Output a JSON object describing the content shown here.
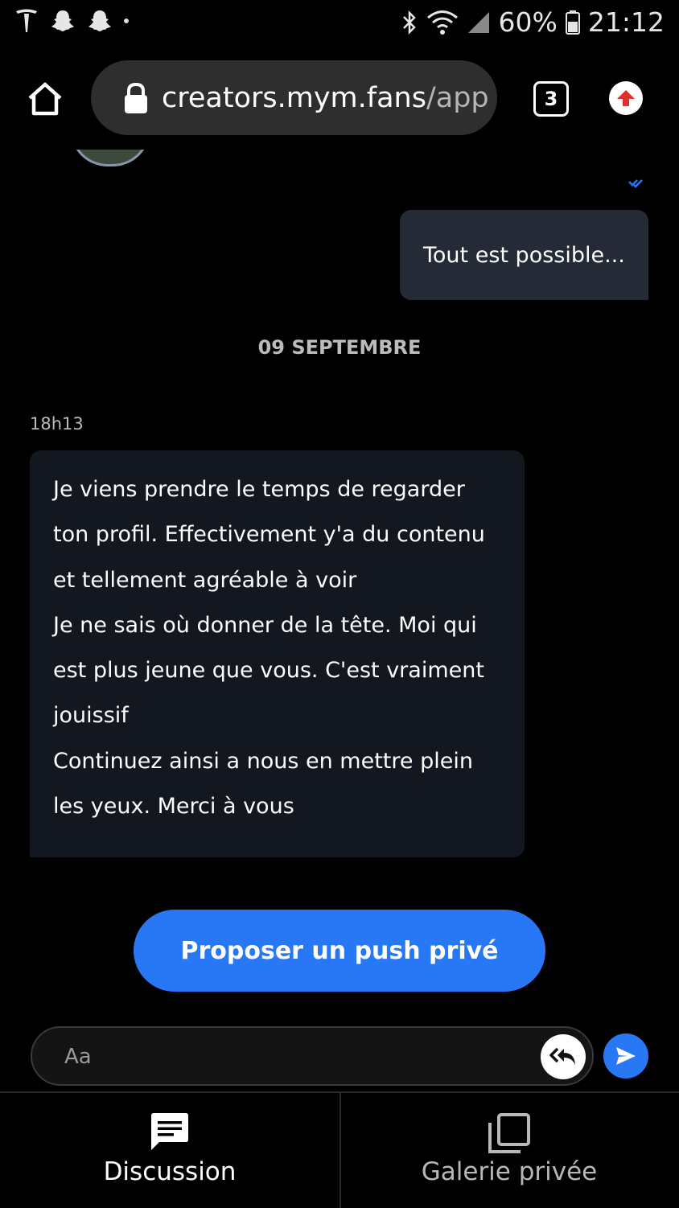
{
  "status_bar": {
    "battery": "60%",
    "time": "21:12",
    "left_icons": [
      "tesla-icon",
      "snapchat-icon",
      "snapchat-icon",
      "dot"
    ],
    "right_icons": [
      "bluetooth-icon",
      "wifi-icon",
      "signal-icon",
      "battery-icon"
    ]
  },
  "browser": {
    "url_host": "creators.mym.fans",
    "url_path": "/app",
    "tab_count": "3"
  },
  "chat": {
    "outgoing_message": "Tout est possible...",
    "date_separator": "09 SEPTEMBRE",
    "incoming_time": "18h13",
    "incoming_lines": [
      "Je viens prendre le temps de regarder",
      "ton profil. Effectivement y'a du contenu",
      "et tellement agréable à voir",
      "Je ne sais où donner de la tête. Moi qui",
      "est plus jeune que vous. C'est vraiment",
      "jouissif",
      "Continuez ainsi a nous en mettre plein",
      "les yeux. Merci à vous"
    ],
    "push_button_label": "Proposer un push privé"
  },
  "composer": {
    "placeholder": "Aa",
    "value": ""
  },
  "bottom_nav": {
    "tabs": [
      {
        "label": "Discussion",
        "icon": "chat-icon",
        "active": true
      },
      {
        "label": "Galerie privée",
        "icon": "gallery-icon",
        "active": false
      }
    ]
  },
  "colors": {
    "accent": "#2878f6",
    "outgoing_bubble": "#252b36",
    "incoming_bubble": "#13171f",
    "background": "#000000"
  }
}
